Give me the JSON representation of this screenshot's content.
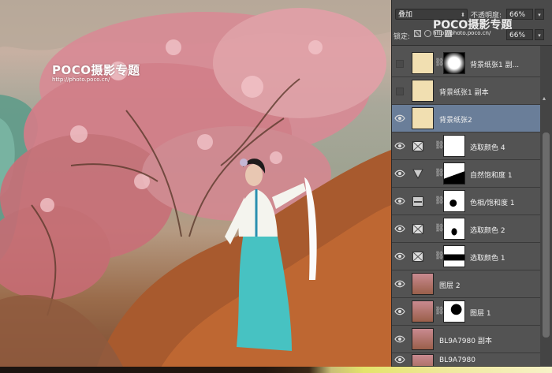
{
  "watermark": {
    "photo_logo": "POCO摄影专题",
    "photo_url": "http://photo.poco.cn/",
    "panel_logo": "POCO摄影专题",
    "panel_url": "http://photo.poco.cn/"
  },
  "layers_panel": {
    "blend_mode": "叠加",
    "opacity_label": "不透明度:",
    "opacity_value": "66%",
    "lock_label": "锁定:",
    "fill_value": "66%",
    "layers": [
      {
        "name": "背景纸张1 副...",
        "visible": false,
        "kind": "image-mask",
        "selected": false
      },
      {
        "name": "背景纸张1 副本",
        "visible": false,
        "kind": "image",
        "selected": false
      },
      {
        "name": "背景纸张2",
        "visible": true,
        "kind": "image",
        "selected": true
      },
      {
        "name": "选取颜色 4",
        "visible": true,
        "kind": "adjust-selective-color",
        "selected": false
      },
      {
        "name": "自然饱和度 1",
        "visible": true,
        "kind": "adjust-vibrance",
        "selected": false
      },
      {
        "name": "色相/饱和度 1",
        "visible": true,
        "kind": "adjust-hue",
        "selected": false
      },
      {
        "name": "选取颜色 2",
        "visible": true,
        "kind": "adjust-selective-color",
        "selected": false
      },
      {
        "name": "选取颜色 1",
        "visible": true,
        "kind": "adjust-selective-color",
        "selected": false
      },
      {
        "name": "图层 2",
        "visible": true,
        "kind": "photo",
        "selected": false
      },
      {
        "name": "图层 1",
        "visible": true,
        "kind": "photo-mask",
        "selected": false
      },
      {
        "name": "BL9A7980 副本",
        "visible": true,
        "kind": "photo",
        "selected": false
      },
      {
        "name": "BL9A7980",
        "visible": true,
        "kind": "photo",
        "selected": false
      }
    ]
  },
  "colors": {
    "panel_bg": "#535353",
    "selected_row": "#6a7e99",
    "paper_thumb": "#f1dfb1"
  }
}
